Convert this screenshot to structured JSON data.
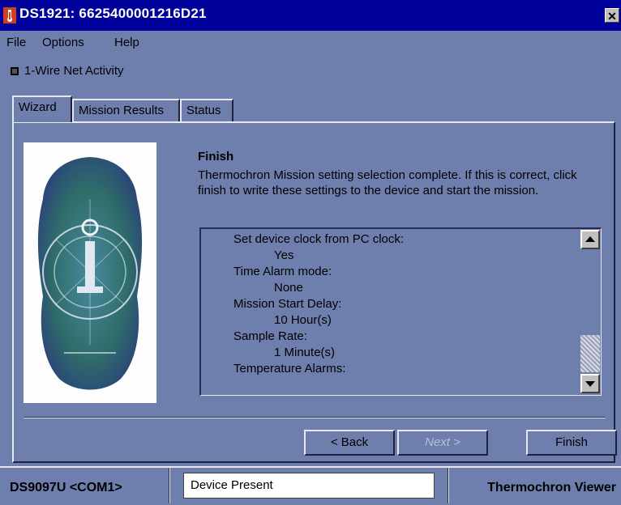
{
  "window": {
    "title": "DS1921:  6625400001216D21",
    "icon": "thermometer-app-icon",
    "close_label": "✕"
  },
  "menu": {
    "items": [
      "File",
      "Options",
      "Help"
    ]
  },
  "activity": {
    "label": "1-Wire Net Activity"
  },
  "tabs": [
    {
      "label": "Wizard",
      "active": true
    },
    {
      "label": "Mission Results",
      "active": false
    },
    {
      "label": "Status",
      "active": false
    }
  ],
  "wizard": {
    "heading": "Finish",
    "description": "Thermochron Mission setting selection complete.  If this is correct, click finish to write these settings to the device and start the mission.",
    "settings": [
      {
        "label": "Set device clock from PC clock:",
        "value": "Yes"
      },
      {
        "label": "Time Alarm mode:",
        "value": "None"
      },
      {
        "label": "Mission Start Delay:",
        "value": "10 Hour(s)"
      },
      {
        "label": "Sample Rate:",
        "value": "1 Minute(s)"
      },
      {
        "label": "Temperature Alarms:",
        "value": ""
      }
    ]
  },
  "buttons": {
    "back": "< Back",
    "next": "Next >",
    "finish": "Finish"
  },
  "status": {
    "adapter": "DS9097U <COM1>",
    "device": "Device Present",
    "app": "Thermochron Viewer"
  },
  "colors": {
    "background": "#6f7fad",
    "titlebar": "#00009a"
  }
}
